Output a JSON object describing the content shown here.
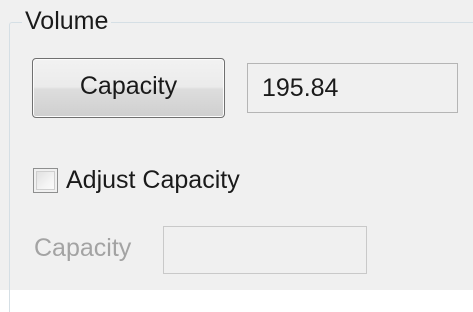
{
  "volume_group": {
    "title": "Volume",
    "capacity_button_label": "Capacity",
    "capacity_value": "195.84",
    "adjust_checkbox_label": "Adjust Capacity",
    "adjust_checked": false,
    "adjusted_capacity_label": "Capacity",
    "adjusted_capacity_value": ""
  }
}
